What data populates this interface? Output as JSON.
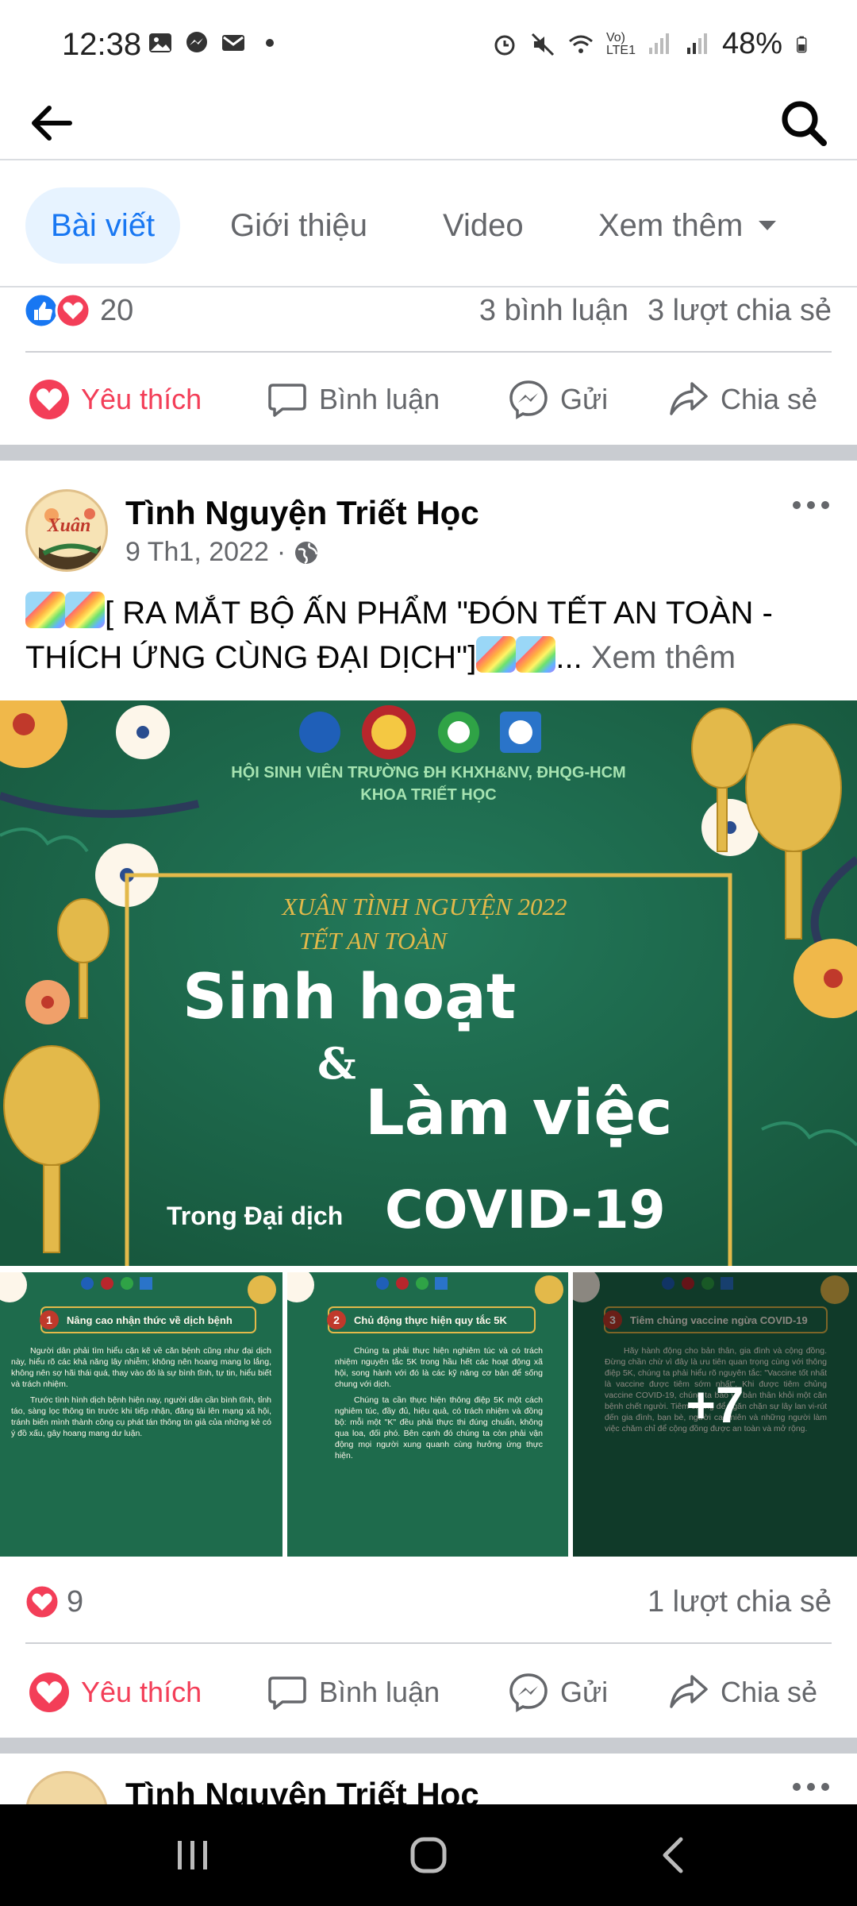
{
  "status_bar": {
    "time": "12:38",
    "battery": "48%",
    "network_label": "Vo) LTE1",
    "left_icons": [
      "gallery-icon",
      "messenger-icon",
      "mail-icon",
      "dot-icon"
    ],
    "right_icons": [
      "alarm-icon",
      "mute-icon",
      "wifi-icon",
      "signal-icon",
      "signal-icon",
      "battery-icon"
    ]
  },
  "app_bar": {
    "back_icon": "arrow-left-icon",
    "search_icon": "search-icon"
  },
  "tabs": [
    {
      "label": "Bài viết",
      "active": true
    },
    {
      "label": "Giới thiệu",
      "active": false
    },
    {
      "label": "Video",
      "active": false
    },
    {
      "label": "Xem thêm",
      "active": false
    }
  ],
  "prev_post": {
    "reaction_count": "20",
    "comments": "3 bình luận",
    "shares": "3 lượt chia sẻ"
  },
  "actions": {
    "like": "Yêu thích",
    "comment": "Bình luận",
    "send": "Gửi",
    "share": "Chia sẻ"
  },
  "post": {
    "page_name": "Tình Nguyện Triết Học",
    "date": "9 Th1, 2022",
    "dot": "·",
    "text_main": "[ RA MẮT BỘ ẤN PHẨM \"ĐÓN TẾT AN TOÀN - THÍCH ỨNG CÙNG ĐẠI DỊCH\"]",
    "text_ellipsis": "...",
    "see_more": "Xem thêm",
    "avatar_text": "Xuân",
    "image": {
      "org_line1": "HỘI SINH VIÊN TRƯỜNG ĐH KHXH&NV, ĐHQG-HCM",
      "org_line2": "KHOA TRIẾT HỌC",
      "subtitle1": "XUÂN TÌNH NGUYỆN 2022",
      "subtitle2": "TẾT AN TOÀN",
      "title1": "Sinh hoạt",
      "amp": "&",
      "title2": "Làm việc",
      "title3_small": "Trong Đại dịch",
      "title3_big": "COVID-19"
    },
    "thumbs": [
      {
        "num": "1",
        "heading": "Nâng cao nhận thức về dịch bệnh",
        "para1": "Người dân phải tìm hiểu cặn kẽ về căn bệnh cũng như đại dịch này, hiểu rõ các khả năng lây nhiễm; không nên hoang mang lo lắng, không nên sợ hãi thái quá, thay vào đó là sự bình tĩnh, tự tin, hiểu biết và trách nhiệm.",
        "para2": "Trước tình hình dịch bệnh hiện nay, người dân cần bình tĩnh, tỉnh táo, sàng lọc thông tin trước khi tiếp nhận, đăng tải lên mạng xã hội, tránh biến mình thành công cụ phát tán thông tin giả của những kẻ có ý đồ xấu, gây hoang mang dư luận."
      },
      {
        "num": "2",
        "heading": "Chủ động thực hiện quy tắc 5K",
        "para1": "Chúng ta phải thực hiện nghiêm túc và có trách nhiệm nguyên tắc 5K trong hầu hết các hoạt động xã hội, song hành với đó là các kỹ năng cơ bản để sống chung với dịch.",
        "para2": "Chúng ta cần thực hiện thông điệp 5K một cách nghiêm túc, đầy đủ, hiệu quả, có trách nhiệm và đồng bộ: mỗi một \"K\" đều phải thực thi đúng chuẩn, không qua loa, đối phó. Bên cạnh đó chúng ta còn phải vận động mọi người xung quanh cùng hưởng ứng thực hiện."
      },
      {
        "num": "3",
        "heading": "Tiêm chủng vaccine ngừa COVID-19",
        "para1": "Hãy hành động cho bản thân, gia đình và cộng đồng. Đừng chần chừ vì đây là ưu tiên quan trọng cùng với thông điệp 5K, chúng ta phải hiểu rõ nguyên tắc: \"Vaccine tốt nhất là vaccine được tiêm sớm nhất\". Khi được tiêm chủng vaccine COVID-19, chúng ta bảo vệ bản thân khỏi một căn bệnh chết người. Tiêm chủng để ngăn chặn sự lây lan vi-rút đến gia đình, bạn bè, người cao niên và những người làm việc chăm chỉ để cộng đồng được an toàn và mở rộng.",
        "para2": ""
      }
    ],
    "more_photos": "+7",
    "reaction_count": "9",
    "shares": "1 lượt chia sẻ"
  },
  "next_post": {
    "page_name": "Tình Nguyện Triết Học"
  },
  "nav_bar": {
    "icons": [
      "recent-apps-icon",
      "home-icon",
      "back-icon"
    ]
  },
  "colors": {
    "facebook_blue": "#1877f2",
    "like_red": "#f33e58",
    "poster_green": "#1e6b4c",
    "gold": "#e3b94a"
  }
}
